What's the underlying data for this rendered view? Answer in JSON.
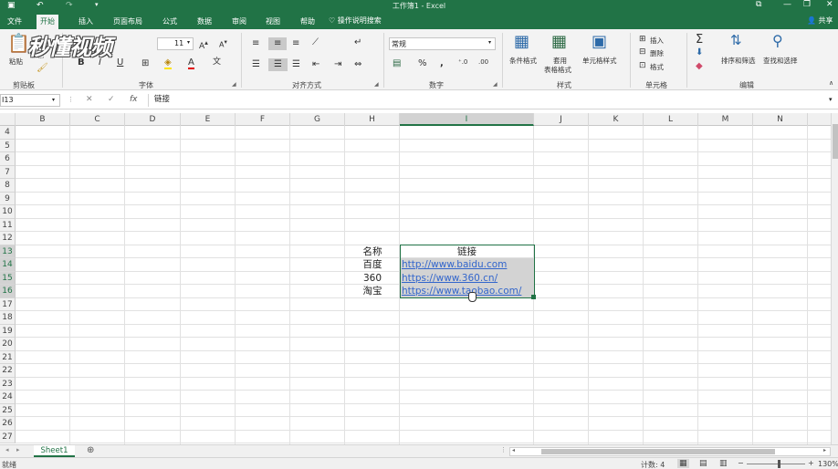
{
  "title": "工作簿1 - Excel",
  "watermark": "秒懂视频",
  "tabs": [
    "文件",
    "开始",
    "插入",
    "页面布局",
    "公式",
    "数据",
    "审阅",
    "视图",
    "帮助"
  ],
  "active_tab": "开始",
  "tell_me": "操作说明搜索",
  "share": "共享",
  "ribbon": {
    "paste": "粘贴",
    "clipboard": "剪贴板",
    "font_size": "11",
    "font_group": "字体",
    "align_group": "对齐方式",
    "number_format": "常规",
    "number_group": "数字",
    "cond_format": "条件格式",
    "table_format_1": "套用",
    "table_format_2": "表格格式",
    "cell_styles": "单元格样式",
    "styles_group": "样式",
    "insert": "插入",
    "delete": "删除",
    "format": "格式",
    "cells_group": "单元格",
    "sort_filter": "排序和筛选",
    "find_select": "查找和选择",
    "edit_group": "编辑"
  },
  "formula_bar": {
    "name_box": "I13",
    "fx": "fx",
    "content": "链接"
  },
  "columns": [
    "B",
    "C",
    "D",
    "E",
    "F",
    "G",
    "H",
    "I",
    "J",
    "K",
    "L",
    "M",
    "N"
  ],
  "selected_column": "I",
  "rows": [
    "4",
    "5",
    "6",
    "7",
    "8",
    "9",
    "10",
    "11",
    "12",
    "13",
    "14",
    "15",
    "16",
    "17",
    "18",
    "19",
    "20",
    "21",
    "22",
    "23",
    "24",
    "25",
    "26",
    "27"
  ],
  "selected_rows": [
    "13",
    "14",
    "15",
    "16"
  ],
  "cells": {
    "h13": "名称",
    "i13": "链接",
    "h14": "百度",
    "i14": "http://www.baidu.com",
    "h15": "360",
    "i15": "https://www.360.cn/",
    "h16": "淘宝",
    "i16": "https://www.taobao.com/"
  },
  "sheet_tab": "Sheet1",
  "status": {
    "ready": "就绪",
    "count": "计数: 4",
    "zoom": "130%"
  },
  "colors": {
    "excel_green": "#217346",
    "link_blue": "#3366cc"
  }
}
